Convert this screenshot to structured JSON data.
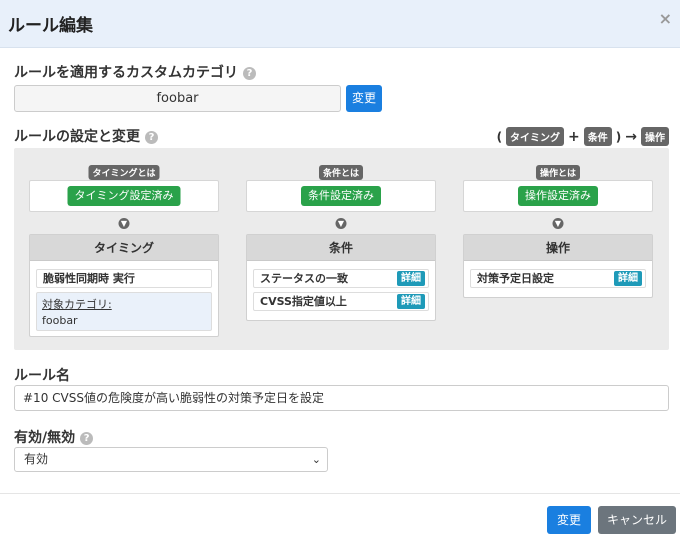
{
  "dialog": {
    "title": "ルール編集",
    "close_glyph": "×"
  },
  "category": {
    "heading": "ルールを適用するカスタムカテゴリ",
    "value": "foobar",
    "change_label": "変更"
  },
  "settings": {
    "heading": "ルールの設定と変更",
    "legend": {
      "open": "(",
      "timing": "タイミング",
      "plus": "+",
      "condition": "条件",
      "close": ")",
      "arrow": "→",
      "operation": "操作"
    },
    "columns": [
      {
        "tag": "タイミングとは",
        "status": "タイミング設定済み",
        "title": "タイミング",
        "rows": [
          "脆弱性同期時 実行"
        ],
        "target_label": "対象カテゴリ:",
        "target_value": "foobar"
      },
      {
        "tag": "条件とは",
        "status": "条件設定済み",
        "title": "条件",
        "rows": [
          "ステータスの一致",
          "CVSS指定値以上"
        ],
        "detail_label": "詳細"
      },
      {
        "tag": "操作とは",
        "status": "操作設定済み",
        "title": "操作",
        "rows": [
          "対策予定日設定"
        ],
        "detail_label": "詳細"
      }
    ]
  },
  "rule_name": {
    "heading": "ルール名",
    "value": "#10 CVSS値の危険度が高い脆弱性の対策予定日を設定"
  },
  "enabled": {
    "heading": "有効/無効",
    "selected": "有効"
  },
  "footer": {
    "change_label": "変更",
    "cancel_label": "キャンセル"
  },
  "colors": {
    "primary": "#1a7fe0",
    "success": "#2aa24a",
    "info": "#1e9ab8",
    "secondary": "#6c757d",
    "header_bg": "#e8f0fa"
  }
}
